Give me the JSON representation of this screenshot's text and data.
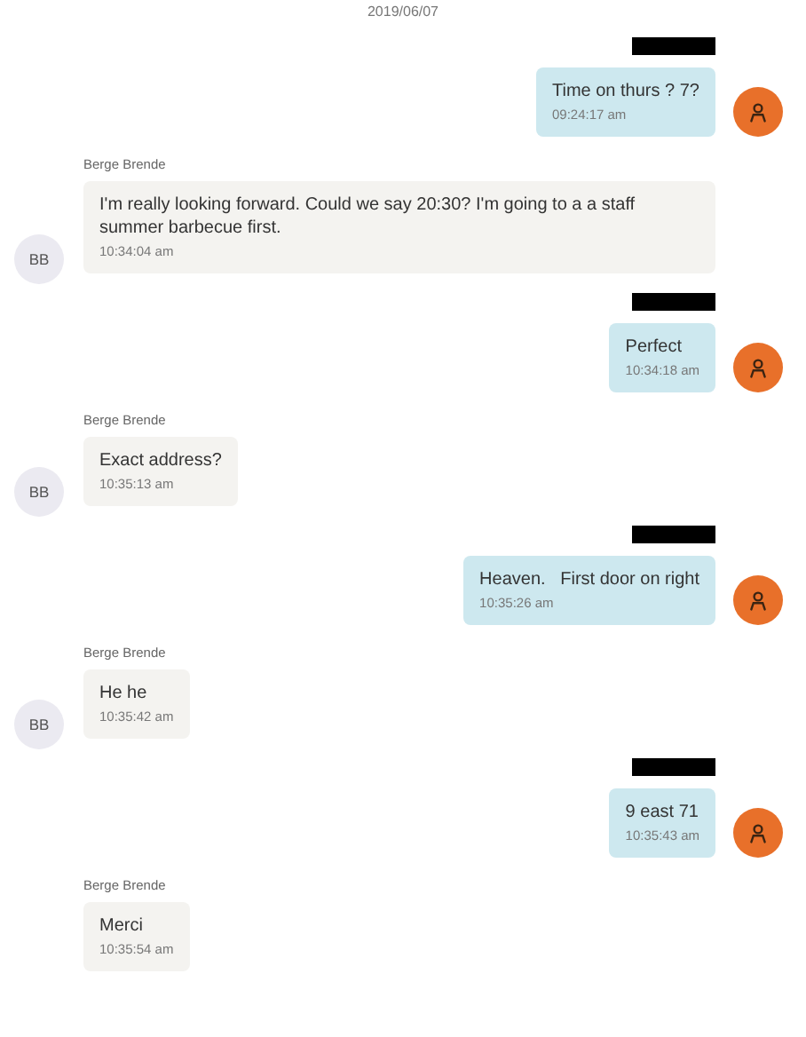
{
  "date": "2019/06/07",
  "messages": [
    {
      "kind": "outgoing",
      "redacted_name": true,
      "text": "Time on thurs ? 7?",
      "time": "09:24:17 am"
    },
    {
      "kind": "incoming",
      "sender": "Berge Brende",
      "avatar": "BB",
      "text": "I'm really looking forward. Could we say 20:30? I'm going to a a staff summer barbecue first.",
      "time": "10:34:04 am"
    },
    {
      "kind": "outgoing",
      "redacted_name": true,
      "text": "Perfect",
      "time": "10:34:18 am"
    },
    {
      "kind": "incoming",
      "sender": "Berge Brende",
      "avatar": "BB",
      "text": "Exact address?",
      "time": "10:35:13 am"
    },
    {
      "kind": "outgoing",
      "redacted_name": true,
      "text": "Heaven.   First door on right",
      "time": "10:35:26 am"
    },
    {
      "kind": "incoming",
      "sender": "Berge Brende",
      "avatar": "BB",
      "text": "He he",
      "time": "10:35:42 am"
    },
    {
      "kind": "outgoing",
      "redacted_name": true,
      "text": "9 east 71",
      "time": "10:35:43 am"
    },
    {
      "kind": "incoming",
      "sender": "Berge Brende",
      "text": "Merci",
      "time": "10:35:54 am"
    }
  ]
}
